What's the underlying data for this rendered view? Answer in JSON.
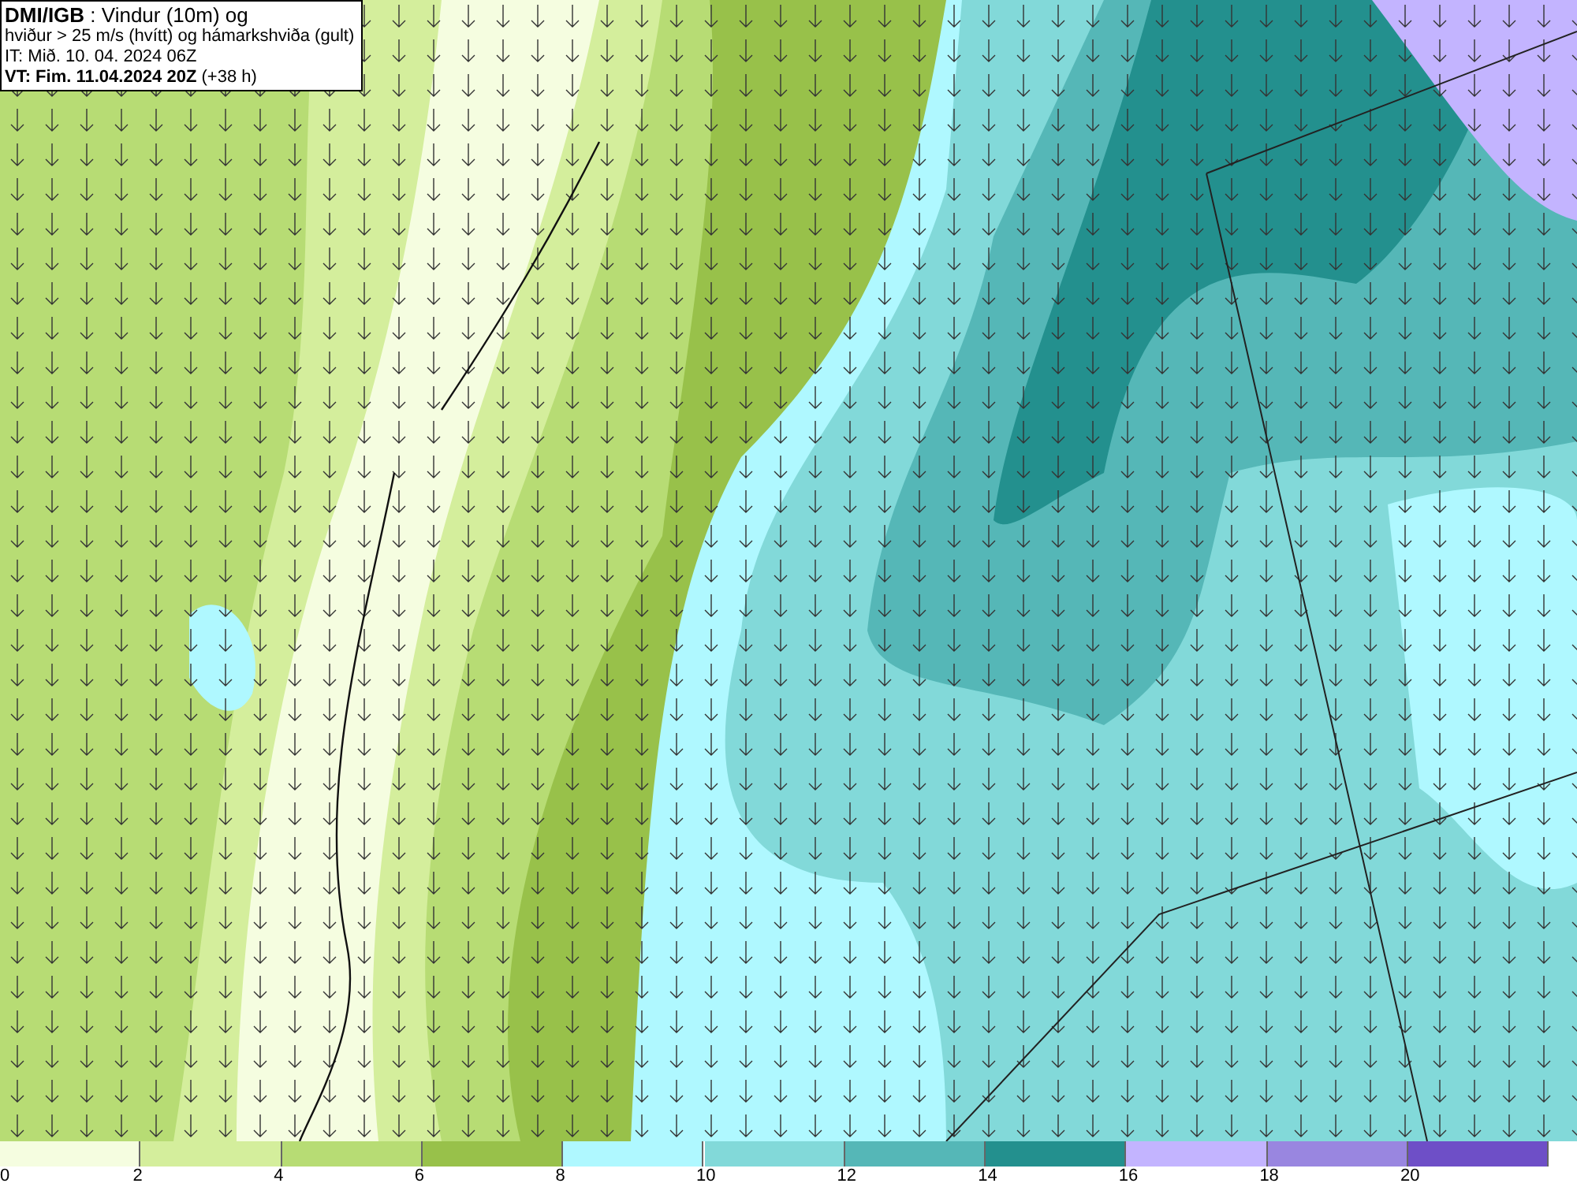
{
  "info_box": {
    "lines": [
      "**DMI/IGB** : Vindur (10m) og",
      "hviður > 25 m/s (hvítt) og hámarkshviða (gult)",
      "IT: Mið. 10. 04. 2024 06Z",
      "**VT: Fim. 11.04.2024 20Z** (+38 h)"
    ]
  },
  "legend": [
    {
      "label": "0",
      "color": "#f5fde0"
    },
    {
      "label": "2",
      "color": "#d4ee9c"
    },
    {
      "label": "4",
      "color": "#b7dc74"
    },
    {
      "label": "6",
      "color": "#98c14a"
    },
    {
      "label": "8",
      "color": "#aff8ff"
    },
    {
      "label": "10",
      "color": "#82d9d9"
    },
    {
      "label": "12",
      "color": "#55b7b7"
    },
    {
      "label": "14",
      "color": "#23908e"
    },
    {
      "label": "16",
      "color": "#c3b4ff"
    },
    {
      "label": "18",
      "color": "#9986e0"
    },
    {
      "label": "20",
      "color": "#6e4fc7"
    }
  ]
}
